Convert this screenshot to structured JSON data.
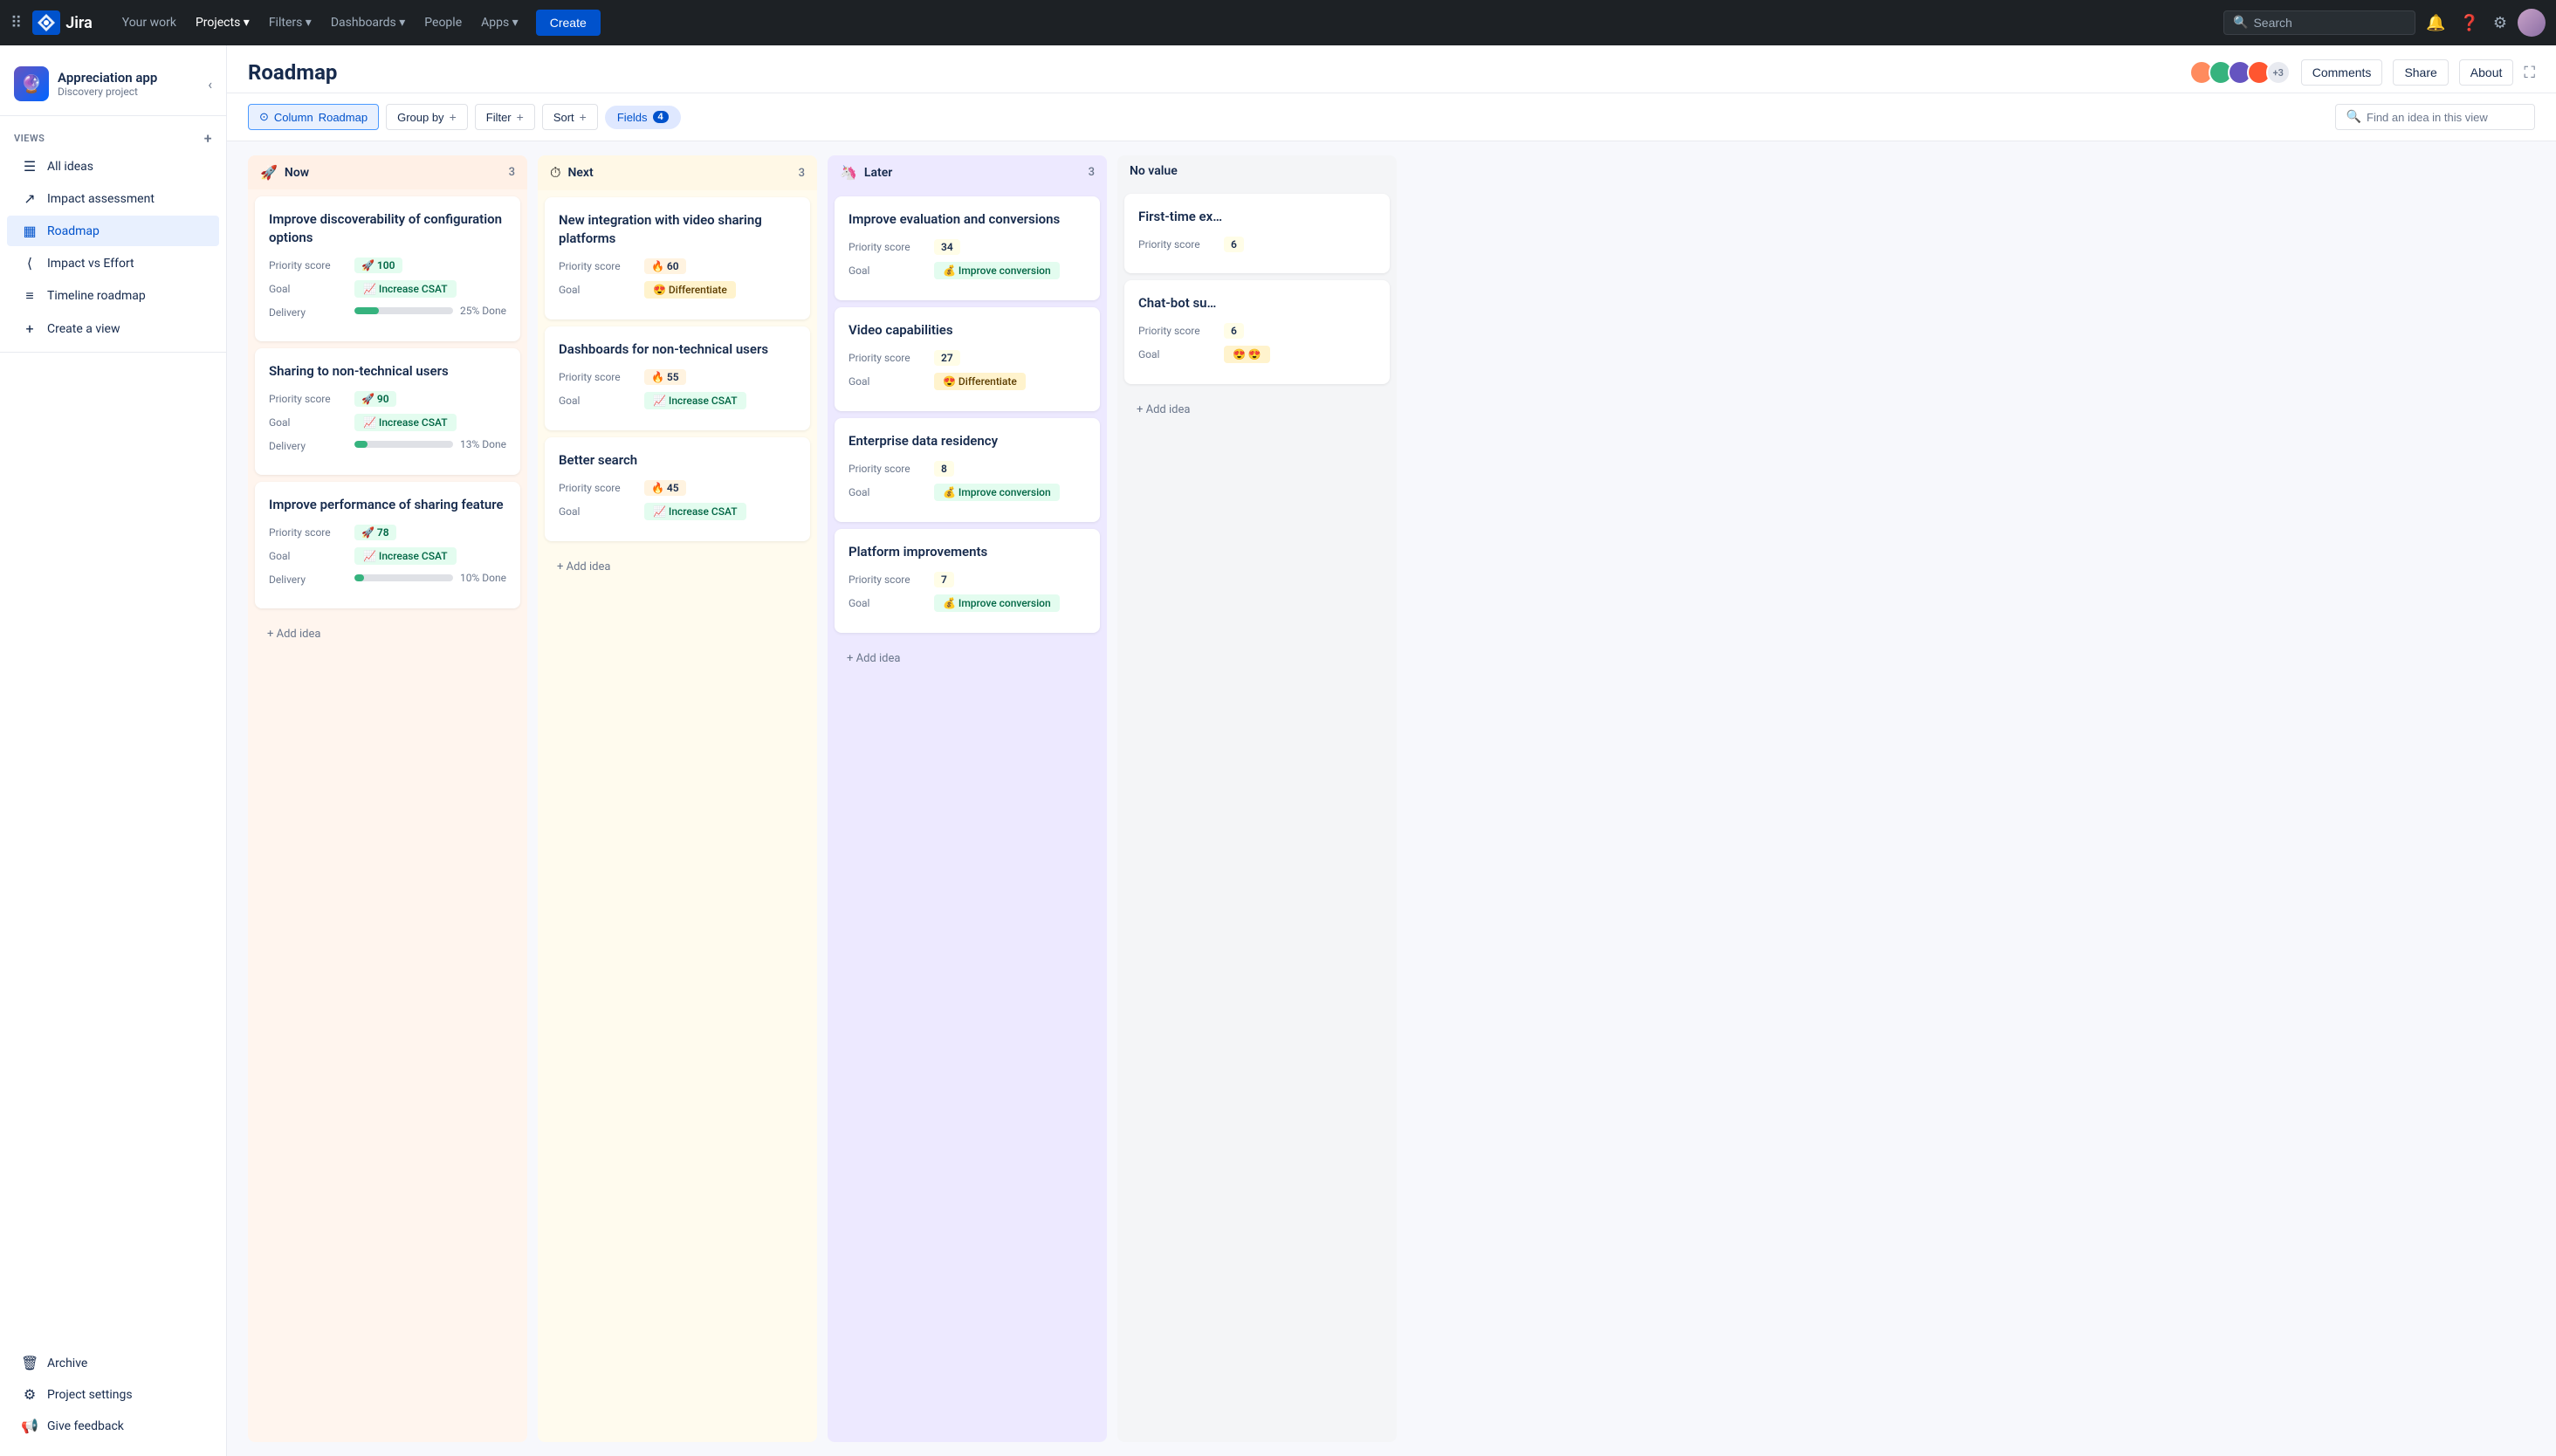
{
  "nav": {
    "logo_text": "Jira",
    "links": [
      "Your work",
      "Projects",
      "Filters",
      "Dashboards",
      "People",
      "Apps"
    ],
    "create_label": "Create",
    "search_placeholder": "Search",
    "icons": [
      "bell",
      "help",
      "settings"
    ]
  },
  "sidebar": {
    "project_name": "Appreciation app",
    "project_type": "Discovery project",
    "views_title": "VIEWS",
    "items": [
      {
        "label": "All ideas",
        "icon": "☰",
        "active": false
      },
      {
        "label": "Impact assessment",
        "icon": "↗",
        "active": false
      },
      {
        "label": "Roadmap",
        "icon": "▦",
        "active": true
      },
      {
        "label": "Impact vs Effort",
        "icon": "⟨",
        "active": false
      },
      {
        "label": "Timeline roadmap",
        "icon": "≡",
        "active": false
      },
      {
        "label": "Create a view",
        "icon": "+",
        "active": false
      }
    ],
    "bottom_items": [
      {
        "label": "Archive",
        "icon": "🗑"
      },
      {
        "label": "Project settings",
        "icon": "⚙"
      },
      {
        "label": "Give feedback",
        "icon": "📢"
      }
    ]
  },
  "page": {
    "title": "Roadmap",
    "header_btns": [
      "Comments",
      "Share",
      "About"
    ],
    "avatar_count": "+3"
  },
  "toolbar": {
    "column_label": "Column",
    "roadmap_label": "Roadmap",
    "group_by_label": "Group by",
    "filter_label": "Filter",
    "sort_label": "Sort",
    "fields_label": "Fields",
    "fields_count": "4",
    "search_placeholder": "Find an idea in this view"
  },
  "columns": [
    {
      "id": "now",
      "emoji": "🚀",
      "title": "Now",
      "count": 3,
      "theme": "now",
      "cards": [
        {
          "title": "Improve discoverability of configuration options",
          "priority_score": "100",
          "score_theme": "green",
          "score_emoji": "🚀",
          "goal": "Increase CSAT",
          "goal_theme": "csat",
          "goal_emoji": "📈",
          "delivery": 25,
          "delivery_text": "25% Done"
        },
        {
          "title": "Sharing to non-technical users",
          "priority_score": "90",
          "score_theme": "green",
          "score_emoji": "🚀",
          "goal": "Increase CSAT",
          "goal_theme": "csat",
          "goal_emoji": "📈",
          "delivery": 13,
          "delivery_text": "13% Done"
        },
        {
          "title": "Improve performance of sharing feature",
          "priority_score": "78",
          "score_theme": "green",
          "score_emoji": "🚀",
          "goal": "Increase CSAT",
          "goal_theme": "csat",
          "goal_emoji": "📈",
          "delivery": 10,
          "delivery_text": "10% Done"
        }
      ]
    },
    {
      "id": "next",
      "emoji": "⏱",
      "title": "Next",
      "count": 3,
      "theme": "next",
      "cards": [
        {
          "title": "New integration with video sharing platforms",
          "priority_score": "60",
          "score_theme": "orange",
          "score_emoji": "🔥",
          "goal": "Differentiate",
          "goal_theme": "differentiate",
          "goal_emoji": "😍",
          "delivery": null,
          "delivery_text": null
        },
        {
          "title": "Dashboards for non-technical users",
          "priority_score": "55",
          "score_theme": "orange",
          "score_emoji": "🔥",
          "goal": "Increase CSAT",
          "goal_theme": "csat",
          "goal_emoji": "📈",
          "delivery": null,
          "delivery_text": null
        },
        {
          "title": "Better search",
          "priority_score": "45",
          "score_theme": "orange",
          "score_emoji": "🔥",
          "goal": "Increase CSAT",
          "goal_theme": "csat",
          "goal_emoji": "📈",
          "delivery": null,
          "delivery_text": null
        }
      ]
    },
    {
      "id": "later",
      "emoji": "🦄",
      "title": "Later",
      "count": 3,
      "theme": "later",
      "cards": [
        {
          "title": "Improve evaluation and conversions",
          "priority_score": "34",
          "score_theme": "yellow",
          "score_emoji": "",
          "goal": "Improve conversion",
          "goal_theme": "conversion",
          "goal_emoji": "💰",
          "delivery": null,
          "delivery_text": null
        },
        {
          "title": "Video capabilities",
          "priority_score": "27",
          "score_theme": "yellow",
          "score_emoji": "",
          "goal": "Differentiate",
          "goal_theme": "differentiate",
          "goal_emoji": "😍",
          "delivery": null,
          "delivery_text": null
        },
        {
          "title": "Enterprise data residency",
          "priority_score": "8",
          "score_theme": "yellow",
          "score_emoji": "",
          "goal": "Improve conversion",
          "goal_theme": "conversion",
          "goal_emoji": "💰",
          "delivery": null,
          "delivery_text": null
        },
        {
          "title": "Platform improvements",
          "priority_score": "7",
          "score_theme": "yellow",
          "score_emoji": "",
          "goal": "Improve conversion",
          "goal_theme": "conversion",
          "goal_emoji": "💰",
          "delivery": null,
          "delivery_text": null
        }
      ]
    },
    {
      "id": "no-value",
      "emoji": "",
      "title": "No value",
      "count": null,
      "theme": "no-value",
      "cards": [
        {
          "title": "First-time ex…",
          "priority_score": "6",
          "score_theme": "yellow",
          "score_emoji": "",
          "goal": null,
          "goal_theme": null,
          "goal_emoji": null,
          "delivery": null,
          "delivery_text": null,
          "partial": true
        },
        {
          "title": "Chat-bot su…",
          "priority_score": "6",
          "score_theme": "yellow",
          "score_emoji": "",
          "goal": "😍",
          "goal_theme": "differentiate",
          "goal_emoji": "😍",
          "delivery": null,
          "delivery_text": null,
          "partial": true
        }
      ]
    }
  ],
  "add_idea_label": "+ Add idea"
}
